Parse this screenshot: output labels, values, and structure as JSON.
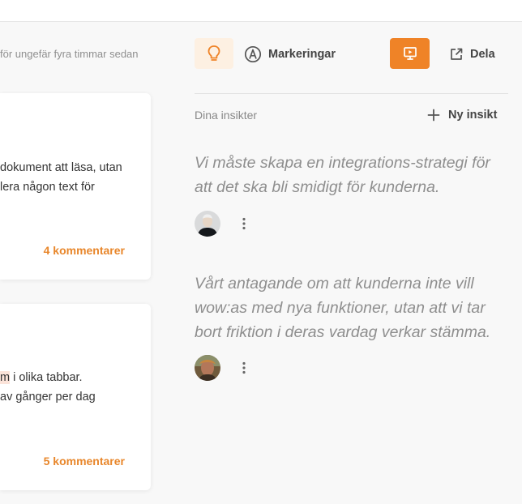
{
  "header": {
    "timestamp": "för ungefär fyra timmar sedan"
  },
  "toolbar": {
    "markings_label": "Markeringar",
    "share_label": "Dela",
    "accent_color": "#ef8327"
  },
  "cards": [
    {
      "lines": [
        "dokument att läsa, utan",
        "lera någon text för"
      ],
      "comments": "4 kommentarer"
    },
    {
      "lines_hl": "m",
      "line1_rest": " i olika tabbar.",
      "line2": "av gånger per dag",
      "comments": "5 kommentarer"
    }
  ],
  "insights": {
    "title": "Dina insikter",
    "new_label": "Ny insikt",
    "items": [
      {
        "lines": [
          "Vi måste skapa en integrations-strategi för",
          "att det ska bli smidigt för kunderna."
        ]
      },
      {
        "lines": [
          "Vårt antagande om att kunderna inte vill",
          "wow:as med nya funktioner, utan att vi tar",
          "bort friktion i deras vardag verkar stämma."
        ]
      }
    ]
  },
  "icons": {
    "bulb": "lightbulb-icon",
    "markings": "pen-circle-icon",
    "present": "presentation-icon",
    "share": "external-link-icon",
    "plus": "plus-icon",
    "kebab": "more-vertical-icon"
  }
}
